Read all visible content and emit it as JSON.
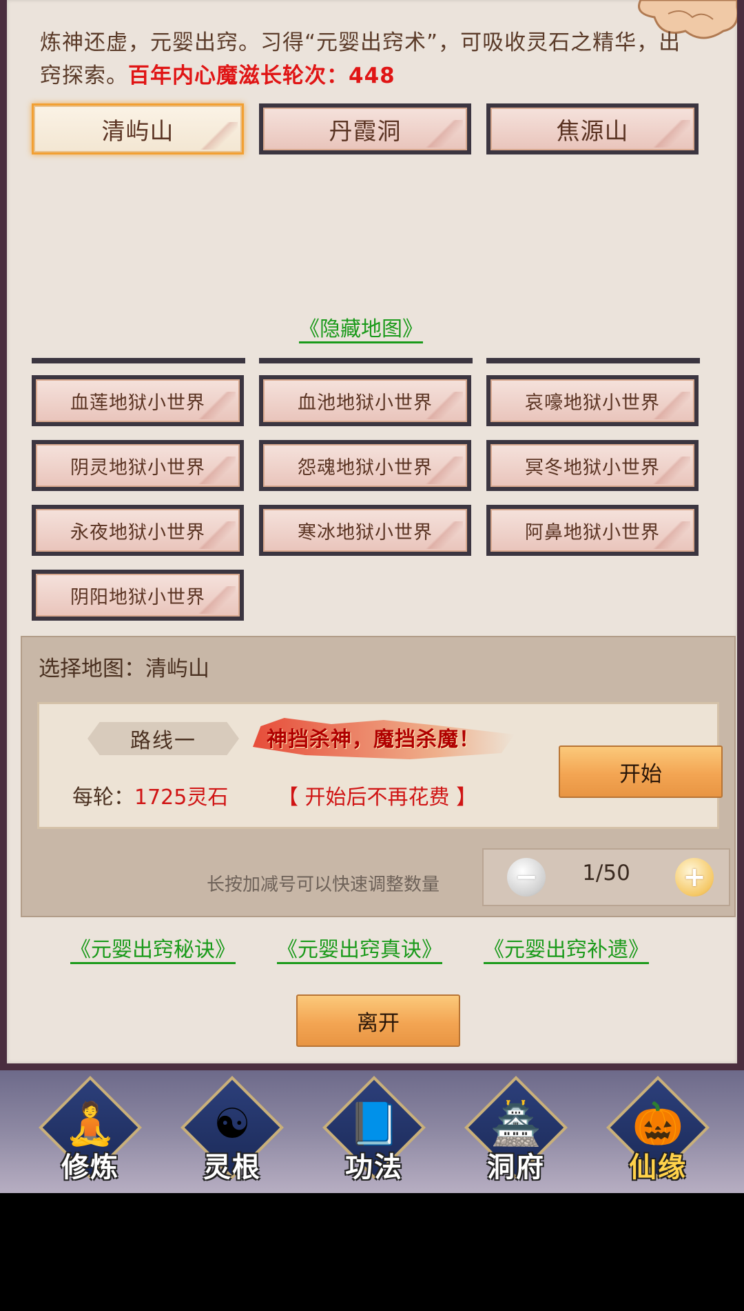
{
  "description": {
    "text": "炼神还虚，元婴出窍。习得“元婴出窍术”，可吸收灵石之精华，出窍探索。",
    "highlight": "百年内心魔滋长轮次：448"
  },
  "main_maps": [
    "清屿山",
    "丹霞洞",
    "焦源山"
  ],
  "hidden_map_link": "《隐藏地图》",
  "hell_maps": [
    "血莲地狱小世界",
    "血池地狱小世界",
    "哀嚎地狱小世界",
    "阴灵地狱小世界",
    "怨魂地狱小世界",
    "冥冬地狱小世界",
    "永夜地狱小世界",
    "寒冰地狱小世界",
    "阿鼻地狱小世界",
    "阴阳地狱小世界"
  ],
  "selection": {
    "label": "选择地图：清屿山",
    "route_name": "路线一",
    "banner": "神挡杀神，魔挡杀魔！",
    "cost_prefix": "每轮：",
    "cost_value": "1725灵石",
    "note": "【 开始后不再花费 】",
    "start_label": "开始",
    "hint": "长按加减号可以快速调整数量",
    "count": "1/50"
  },
  "guide_links": [
    "《元婴出窍秘诀》",
    "《元婴出窍真诀》",
    "《元婴出窍补遗》"
  ],
  "leave_label": "离开",
  "bottom_nav": [
    "修炼",
    "灵根",
    "功法",
    "洞府",
    "仙缘"
  ]
}
